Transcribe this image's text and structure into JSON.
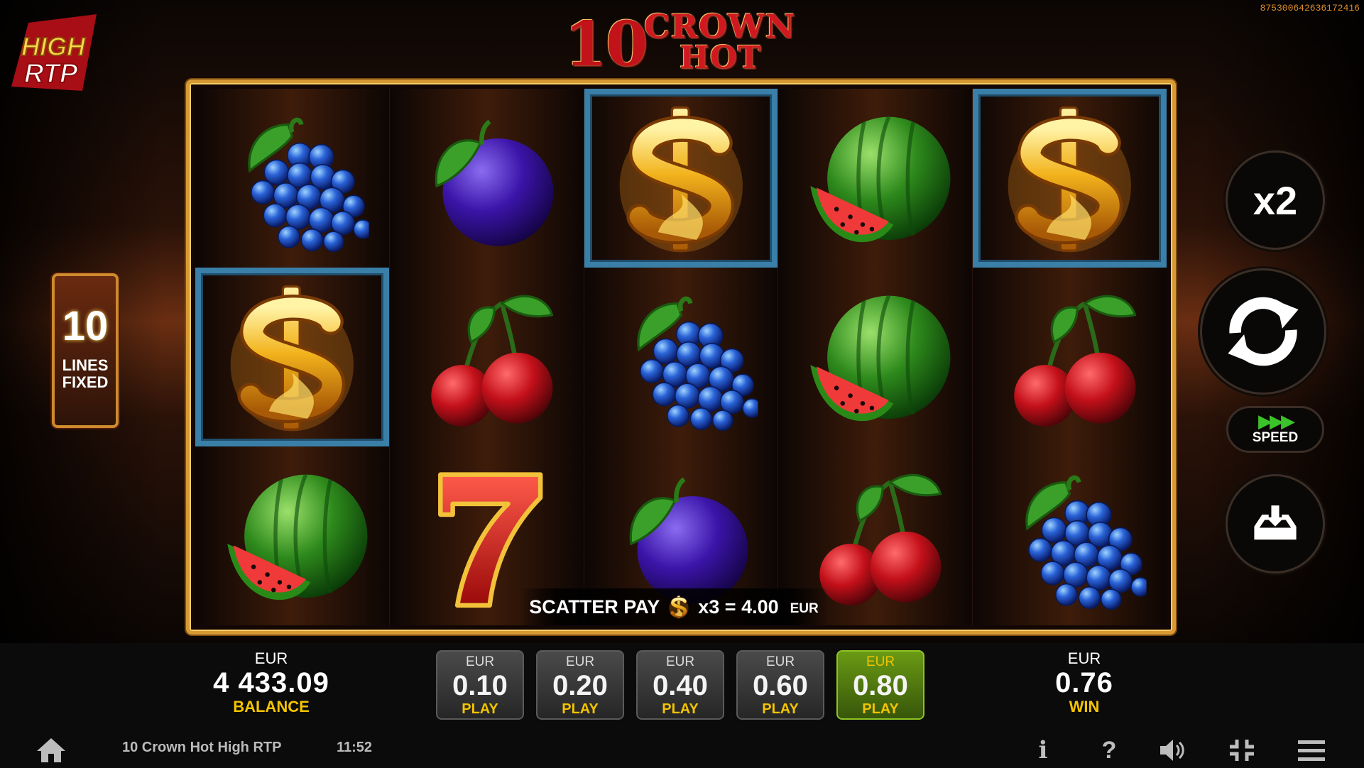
{
  "ticket_id": "875300642636172416",
  "logo": {
    "line1": "HIGH",
    "line2": "RTP"
  },
  "title": {
    "number": "10",
    "word1": "CROWN",
    "word2": "HOT"
  },
  "lines": {
    "count": "10",
    "label1": "LINES",
    "label2": "FIXED"
  },
  "reels": [
    [
      "grapes-icon",
      "dollar-icon",
      "watermelon-icon"
    ],
    [
      "plum-icon",
      "cherries-icon",
      "seven-icon"
    ],
    [
      "dollar-icon",
      "grapes-icon",
      "plum-icon"
    ],
    [
      "watermelon-icon",
      "watermelon-icon",
      "cherries-icon"
    ],
    [
      "dollar-icon",
      "cherries-icon",
      "grapes-icon"
    ]
  ],
  "scatter": {
    "label": "SCATTER PAY",
    "multiplier": "x3 = 4.00",
    "currency": "EUR"
  },
  "controls": {
    "multiplier_label": "x2",
    "speed_label": "SPEED"
  },
  "balance": {
    "currency": "EUR",
    "value": "4 433.09",
    "caption": "BALANCE"
  },
  "bets": [
    {
      "currency": "EUR",
      "value": "0.10",
      "caption": "PLAY"
    },
    {
      "currency": "EUR",
      "value": "0.20",
      "caption": "PLAY"
    },
    {
      "currency": "EUR",
      "value": "0.40",
      "caption": "PLAY"
    },
    {
      "currency": "EUR",
      "value": "0.60",
      "caption": "PLAY"
    },
    {
      "currency": "EUR",
      "value": "0.80",
      "caption": "PLAY"
    }
  ],
  "win": {
    "currency": "EUR",
    "value": "0.76",
    "caption": "WIN"
  },
  "footer": {
    "game_name": "10 Crown Hot High RTP",
    "time": "11:52",
    "info": "i",
    "help": "?"
  },
  "colors": {
    "accent_gold": "#d79a33",
    "highlight_blue": "#3a7fa8",
    "active_bet_green": "#6a9a14",
    "caption_yellow": "#f4c400"
  }
}
